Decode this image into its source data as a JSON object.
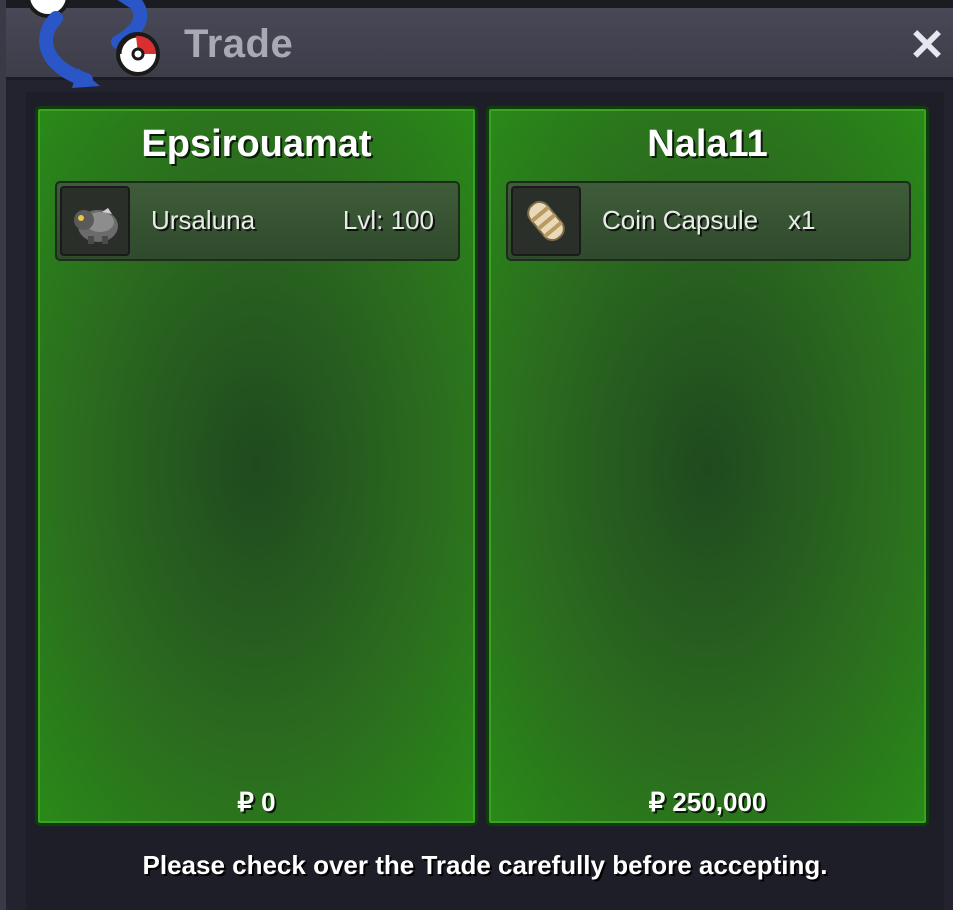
{
  "window": {
    "title": "Trade",
    "close_symbol": "✕"
  },
  "icons": {
    "logo": "trade-swap-icon",
    "close": "close-icon",
    "pokemon": "ursaluna-sprite-icon",
    "item": "coin-capsule-icon"
  },
  "colors": {
    "panel_green": "#2a8a18",
    "panel_dark": "#1f4a1f",
    "title_text": "#a9a9b4"
  },
  "players": [
    {
      "name": "Epsirouamat",
      "offer": {
        "name": "Ursaluna",
        "level_label": "Lvl: 100"
      },
      "money": "₽ 0"
    },
    {
      "name": "Nala11",
      "offer": {
        "name": "Coin Capsule",
        "quantity": "x1"
      },
      "money": "₽ 250,000"
    }
  ],
  "footer": {
    "message": "Please check over the Trade carefully before accepting."
  }
}
